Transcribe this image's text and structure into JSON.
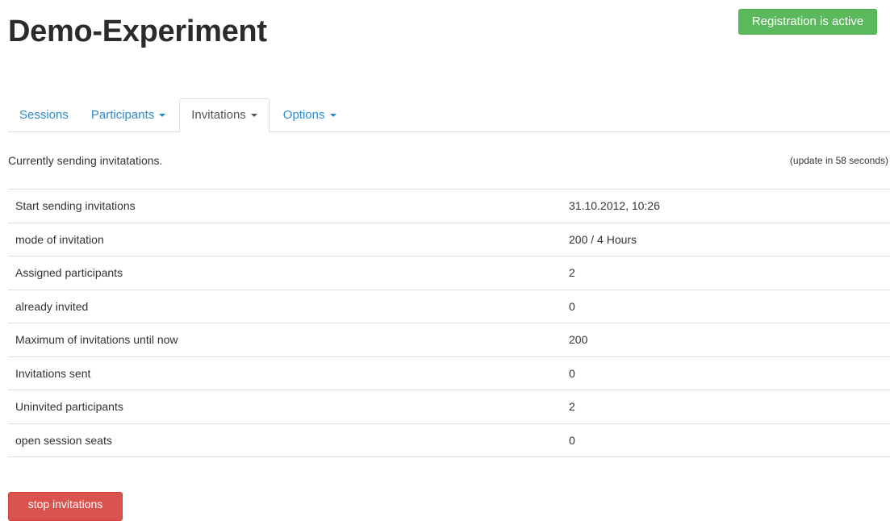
{
  "header": {
    "title": "Demo-Experiment",
    "status_badge": "Registration is active",
    "status_color": "#5cb85c"
  },
  "tabs": [
    {
      "label": "Sessions",
      "active": false,
      "dropdown": false
    },
    {
      "label": "Participants",
      "active": false,
      "dropdown": true
    },
    {
      "label": "Invitations",
      "active": true,
      "dropdown": true
    },
    {
      "label": "Options",
      "active": false,
      "dropdown": true
    }
  ],
  "status": {
    "message": "Currently sending invitatations.",
    "update_note": "(update in 58 seconds)"
  },
  "table": {
    "rows": [
      {
        "label": "Start sending invitations",
        "value": "31.10.2012, 10:26"
      },
      {
        "label": "mode of invitation",
        "value": "200 / 4 Hours"
      },
      {
        "label": "Assigned participants",
        "value": "2"
      },
      {
        "label": "already invited",
        "value": "0"
      },
      {
        "label": "Maximum of invitations until now",
        "value": "200"
      },
      {
        "label": "Invitations sent",
        "value": "0"
      },
      {
        "label": "Uninvited participants",
        "value": "2"
      },
      {
        "label": "open session seats",
        "value": "0"
      }
    ]
  },
  "actions": {
    "stop_label": "stop invitations",
    "stop_color": "#d9534f"
  }
}
